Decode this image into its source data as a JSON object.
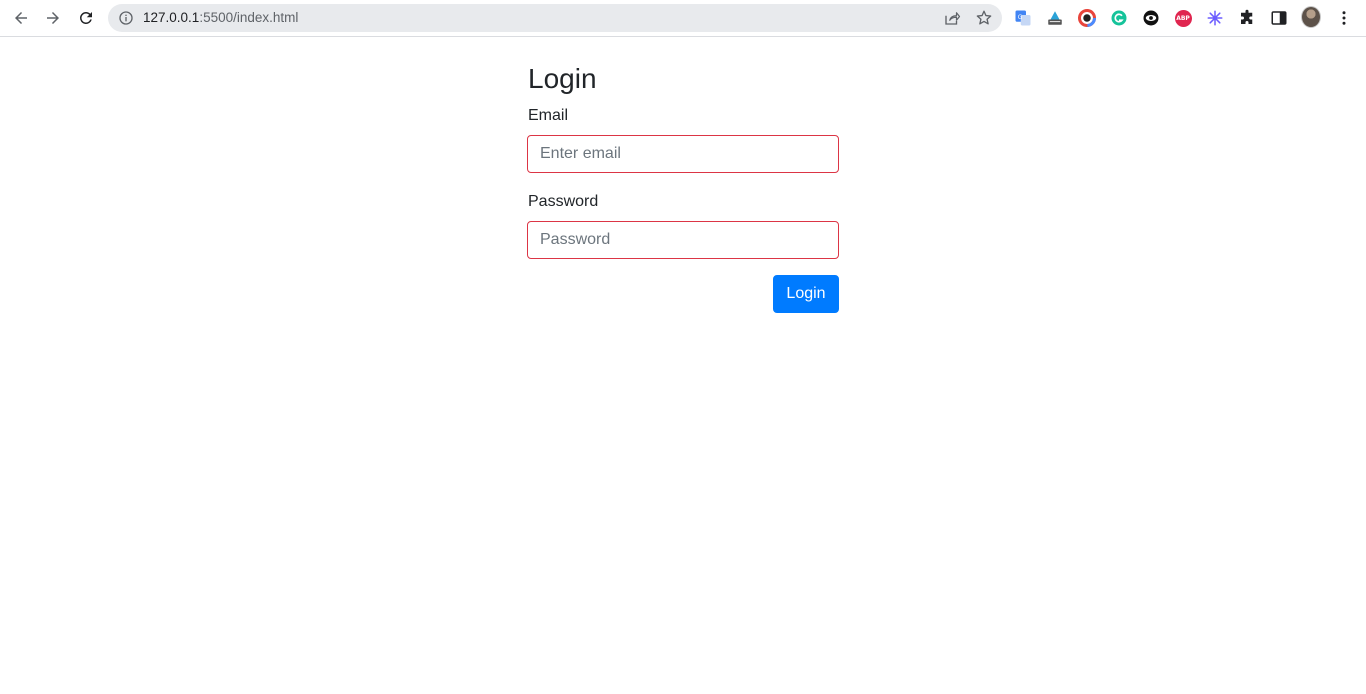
{
  "browser": {
    "url_host": "127.0.0.1",
    "url_rest": ":5500/index.html",
    "extensions": [
      "google-translate-icon",
      "keyboard-extension-icon",
      "color-picker-icon",
      "grammarly-icon",
      "eye-extension-icon",
      "adblock-plus-icon",
      "snowflake-extension-icon",
      "puzzle-extensions-icon"
    ],
    "abp_label": "ABP"
  },
  "form": {
    "title": "Login",
    "email_label": "Email",
    "email_placeholder": "Enter email",
    "email_value": "",
    "password_label": "Password",
    "password_placeholder": "Password",
    "password_value": "",
    "submit_label": "Login"
  },
  "colors": {
    "primary": "#007bff",
    "invalid_border": "#dc3545"
  }
}
